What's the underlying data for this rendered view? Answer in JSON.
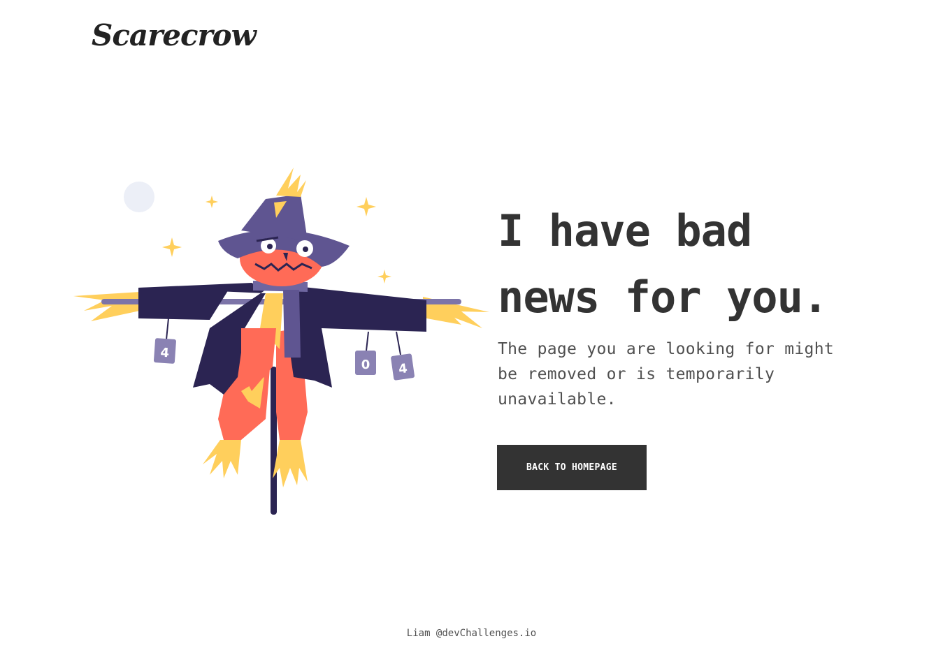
{
  "header": {
    "logo_text": "Scarecrow"
  },
  "main": {
    "headline_line1": "I have bad",
    "headline_line2": "news for you.",
    "description": "The page you are looking for might be removed or is temporarily unavailable.",
    "cta_label": "BACK TO HOMEPAGE"
  },
  "illustration": {
    "can_labels": [
      "4",
      "0",
      "4"
    ],
    "colors": {
      "coat": "#2b2452",
      "hat": "#5f5591",
      "face": "#ff6b57",
      "straw": "#ffcf5c",
      "can": "#8a82b3",
      "moon": "#eceff7",
      "pole": "#2b2452"
    }
  },
  "footer": {
    "credit": "Liam @devChallenges.io"
  }
}
